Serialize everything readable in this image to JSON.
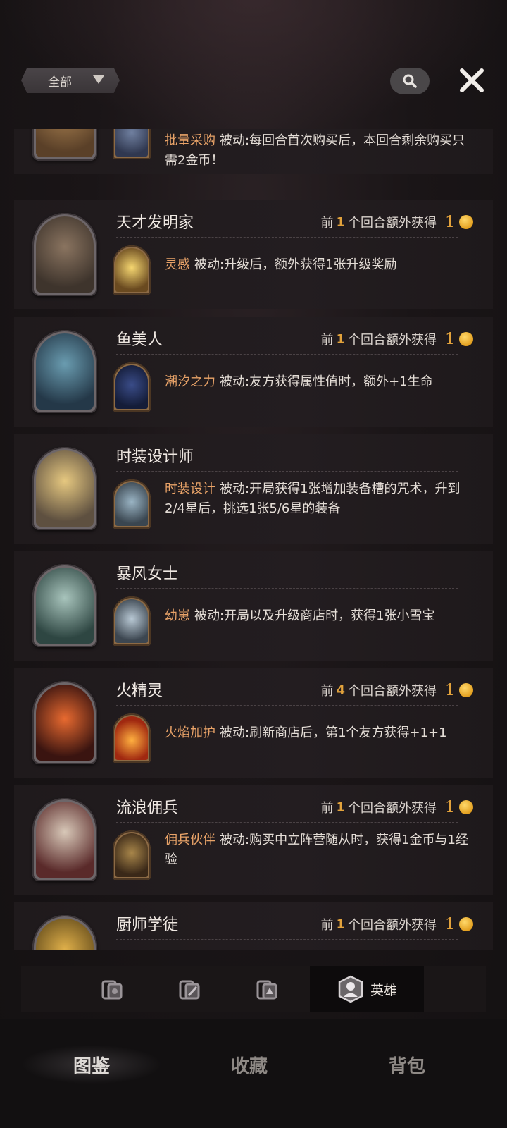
{
  "topbar": {
    "filter_label": "全部"
  },
  "heroes": [
    {
      "name": "",
      "bonus_prefix": "",
      "bonus_num": "",
      "bonus_suffix": "",
      "bonus_reward": "",
      "skill_name": "批量采购",
      "skill_desc": "被动:每回合首次购买后，本回合剩余购买只需2金币！",
      "portrait_color": "#8a6a3a",
      "skill_color": "#4a5a78"
    },
    {
      "name": "天才发明家",
      "bonus_prefix": "前",
      "bonus_num": "1",
      "bonus_suffix": "个回合额外获得",
      "bonus_reward": "1",
      "skill_name": "灵感",
      "skill_desc": "被动:升级后，额外获得1张升级奖励",
      "portrait_color": "#6b5a4c",
      "skill_color": "#e8c45a"
    },
    {
      "name": "鱼美人",
      "bonus_prefix": "前",
      "bonus_num": "1",
      "bonus_suffix": "个回合额外获得",
      "bonus_reward": "1",
      "skill_name": "潮汐之力",
      "skill_desc": "被动:友方获得属性值时，额外+1生命",
      "portrait_color": "#4f7a8c",
      "skill_color": "#2c3c68"
    },
    {
      "name": "时装设计师",
      "bonus_prefix": "",
      "bonus_num": "",
      "bonus_suffix": "",
      "bonus_reward": "",
      "skill_name": "时装设计",
      "skill_desc": "被动:开局获得1张增加装备槽的咒术，升到2/4星后，挑选1张5/6星的装备",
      "portrait_color": "#c9a75a",
      "skill_color": "#7a96a8"
    },
    {
      "name": "暴风女士",
      "bonus_prefix": "",
      "bonus_num": "",
      "bonus_suffix": "",
      "bonus_reward": "",
      "skill_name": "幼崽",
      "skill_desc": "被动:开局以及升级商店时，获得1张小雪宝",
      "portrait_color": "#7fa39a",
      "skill_color": "#8aa0b0"
    },
    {
      "name": "火精灵",
      "bonus_prefix": "前",
      "bonus_num": "4",
      "bonus_suffix": "个回合额外获得",
      "bonus_reward": "1",
      "skill_name": "火焰加护",
      "skill_desc": "被动:刷新商店后，第1个友方获得+1+1",
      "portrait_color": "#b2442a",
      "skill_color": "#d8642a"
    },
    {
      "name": "流浪佣兵",
      "bonus_prefix": "前",
      "bonus_num": "1",
      "bonus_suffix": "个回合额外获得",
      "bonus_reward": "1",
      "skill_name": "佣兵伙伴",
      "skill_desc": "被动:购买中立阵营随从时，获得1金币与1经验",
      "portrait_color": "#8a3a3a",
      "skill_color": "#6a5238"
    },
    {
      "name": "厨师学徒",
      "bonus_prefix": "前",
      "bonus_num": "1",
      "bonus_suffix": "个回合额外获得",
      "bonus_reward": "1",
      "skill_name": "",
      "skill_desc": "",
      "portrait_color": "#c29a3a",
      "skill_color": "#7a6a50"
    }
  ],
  "subtabs": {
    "active_label": "英雄"
  },
  "bottom_nav": {
    "items": [
      "图鉴",
      "收藏",
      "背包"
    ]
  }
}
